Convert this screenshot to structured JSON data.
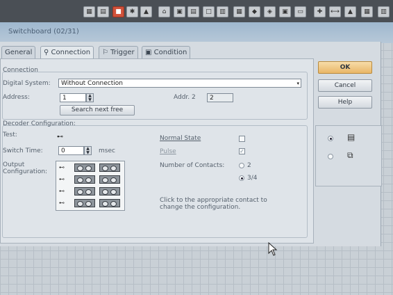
{
  "window_title": "Switchboard (02/31)",
  "tabs": [
    {
      "label": "General"
    },
    {
      "label": "Connection"
    },
    {
      "label": "Trigger"
    },
    {
      "label": "Condition"
    }
  ],
  "connection": {
    "group_label": "Connection",
    "digital_system_label": "Digital System:",
    "digital_system_value": "Without Connection",
    "address_label": "Address:",
    "address_value": "1",
    "addr2_label": "Addr. 2",
    "addr2_value": "2",
    "search_button": "Search next free"
  },
  "decoder": {
    "group_label": "Decoder Configuration:",
    "test_label": "Test:",
    "switch_time_label": "Switch Time:",
    "switch_time_value": "0",
    "switch_time_unit": "msec",
    "output_config_label": "Output Configuration:",
    "normal_state_label": "Normal State",
    "pulse_label": "Pulse",
    "contacts_label": "Number of Contacts:",
    "contacts_options": [
      "2",
      "3/4"
    ],
    "contacts_selected": "3/4",
    "hint": "Click to the appropriate contact to change the configuration."
  },
  "buttons": {
    "ok": "OK",
    "cancel": "Cancel",
    "help": "Help"
  },
  "colors": {
    "ok_button": "#e9b667",
    "topbar": "#4a4f55"
  }
}
